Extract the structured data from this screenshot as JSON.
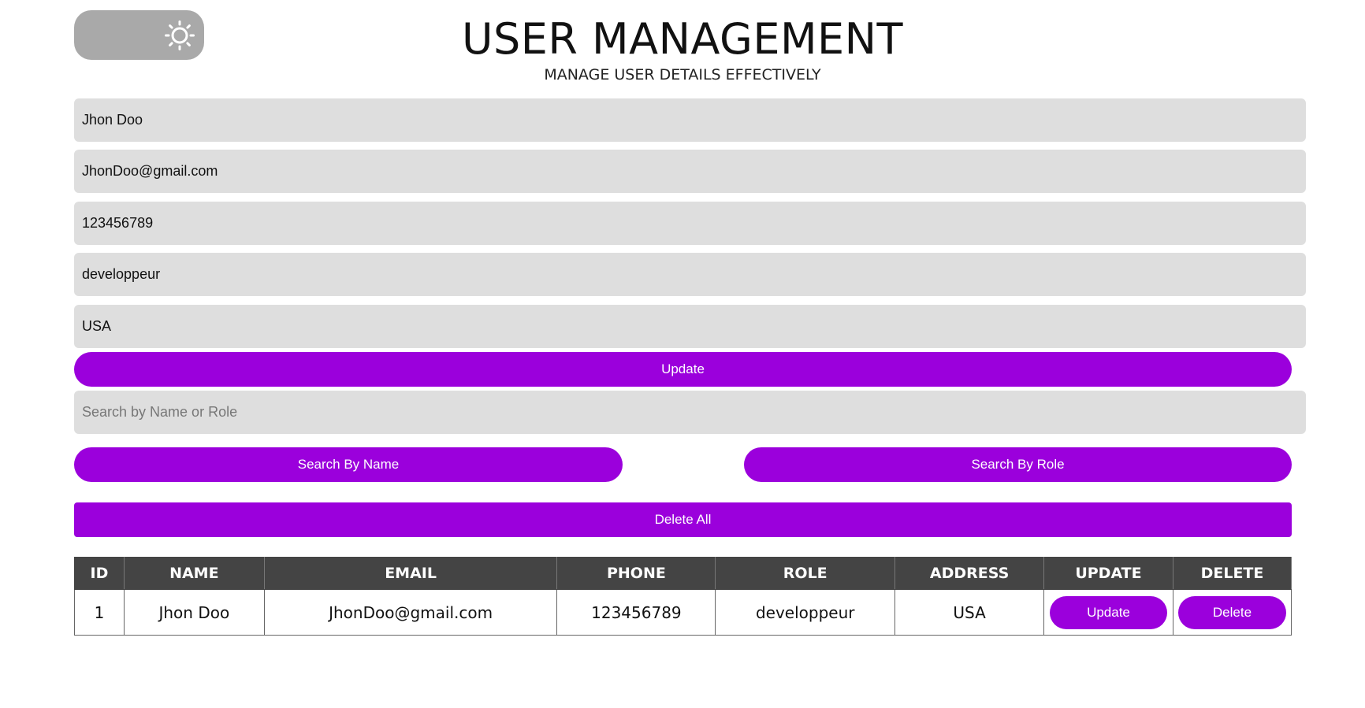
{
  "header": {
    "title": "USER MANAGEMENT",
    "subtitle": "MANAGE USER DETAILS EFFECTIVELY",
    "theme_toggle_icon": "sun-icon"
  },
  "form": {
    "name_value": "Jhon Doo",
    "email_value": "JhonDoo@gmail.com",
    "phone_value": "123456789",
    "role_value": "developpeur",
    "address_value": "USA",
    "update_label": "Update"
  },
  "search": {
    "placeholder": "Search by Name or Role",
    "by_name_label": "Search By Name",
    "by_role_label": "Search By Role",
    "delete_all_label": "Delete All"
  },
  "table": {
    "headers": [
      "ID",
      "NAME",
      "EMAIL",
      "PHONE",
      "ROLE",
      "ADDRESS",
      "UPDATE",
      "DELETE"
    ],
    "rows": [
      {
        "id": "1",
        "name": "Jhon Doo",
        "email": "JhonDoo@gmail.com",
        "phone": "123456789",
        "role": "developpeur",
        "address": "USA",
        "update_label": "Update",
        "delete_label": "Delete"
      }
    ]
  },
  "colors": {
    "accent": "#9b00dc",
    "header_bg": "#444444",
    "field_bg": "#dedede",
    "toggle_bg": "#a9a9a9"
  }
}
